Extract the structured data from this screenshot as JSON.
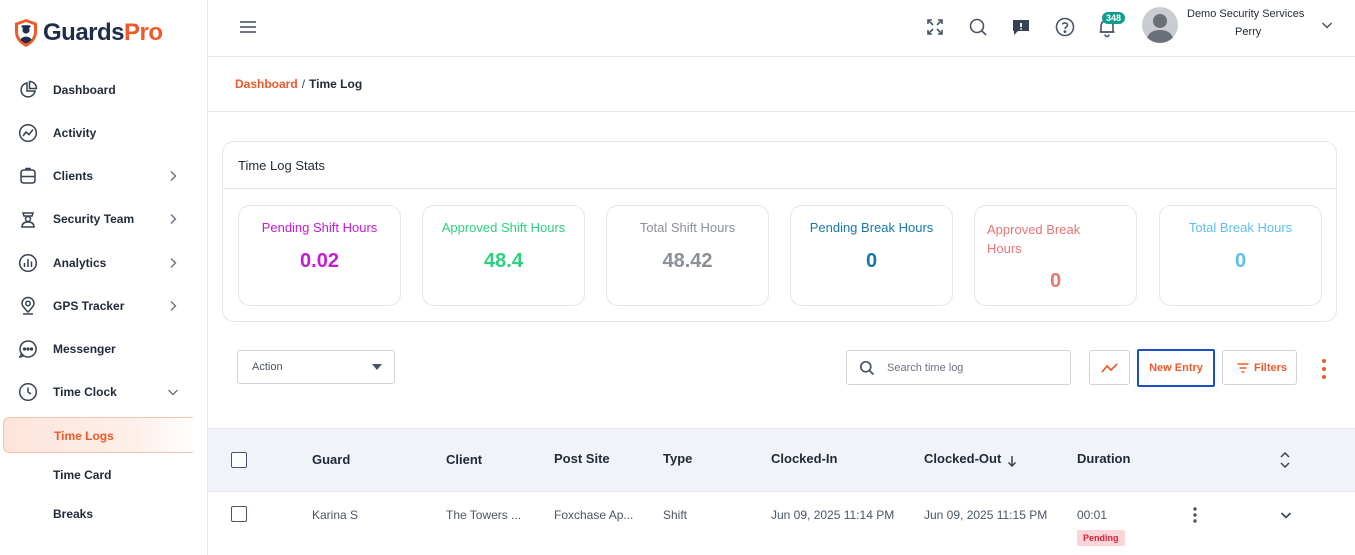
{
  "app": {
    "brand_part1": "Guards",
    "brand_part2": "Pro",
    "colors": {
      "brand_dark": "#1f2d4d",
      "brand_orange": "#ef5a2a",
      "selected_border": "#1a4fc8"
    }
  },
  "sidebar": {
    "items": [
      {
        "label": "Dashboard",
        "icon": "pie-chart-icon",
        "has_chevron": false
      },
      {
        "label": "Activity",
        "icon": "activity-icon",
        "has_chevron": false
      },
      {
        "label": "Clients",
        "icon": "briefcase-icon",
        "has_chevron": true
      },
      {
        "label": "Security Team",
        "icon": "guard-icon",
        "has_chevron": true
      },
      {
        "label": "Analytics",
        "icon": "bar-chart-icon",
        "has_chevron": true
      },
      {
        "label": "GPS Tracker",
        "icon": "location-pin-icon",
        "has_chevron": true
      },
      {
        "label": "Messenger",
        "icon": "chat-bubble-icon",
        "has_chevron": false
      },
      {
        "label": "Time Clock",
        "icon": "clock-icon",
        "has_chevron": true,
        "expanded": true
      }
    ],
    "sub_items": [
      {
        "label": "Time Logs",
        "active": true
      },
      {
        "label": "Time Card",
        "active": false
      },
      {
        "label": "Breaks",
        "active": false
      }
    ]
  },
  "header": {
    "notification_count": "348",
    "user_company": "Demo Security Services",
    "user_name": "Perry",
    "icons": [
      "hamburger-icon",
      "fullscreen-icon",
      "search-icon",
      "feedback-icon",
      "help-icon",
      "bell-icon",
      "chevron-down-icon"
    ]
  },
  "breadcrumb": {
    "parent": "Dashboard",
    "separator": "/",
    "current": "Time Log"
  },
  "stats": {
    "title": "Time Log Stats",
    "cards": [
      {
        "label": "Pending Shift Hours",
        "value": "0.02",
        "color": "#c81ad6"
      },
      {
        "label": "Approved Shift Hours",
        "value": "48.4",
        "color": "#2fcf82"
      },
      {
        "label": "Total Shift Hours",
        "value": "48.42",
        "color": "#8a8f98"
      },
      {
        "label": "Pending Break Hours",
        "value": "0",
        "color": "#1a78a8"
      },
      {
        "label": "Approved Break Hours",
        "value": "0",
        "color": "#e87474"
      },
      {
        "label": "Total Break Hours",
        "value": "0",
        "color": "#5ec0e8"
      }
    ]
  },
  "toolbar": {
    "action_label": "Action",
    "search_placeholder": "Search time log",
    "new_entry_label": "New Entry",
    "filters_label": "Filters"
  },
  "table": {
    "columns": [
      "Guard",
      "Client",
      "Post Site",
      "Type",
      "Clocked-In",
      "Clocked-Out",
      "Duration"
    ],
    "sort_column": "Clocked-Out",
    "sort_direction": "descending",
    "rows": [
      {
        "guard": "Karina S",
        "client": "The Towers ...",
        "post_site": "Foxchase Ap...",
        "type": "Shift",
        "clocked_in": "Jun 09, 2025 11:14 PM",
        "clocked_out": "Jun 09, 2025 11:15 PM",
        "duration": "00:01",
        "status": "Pending"
      }
    ]
  }
}
